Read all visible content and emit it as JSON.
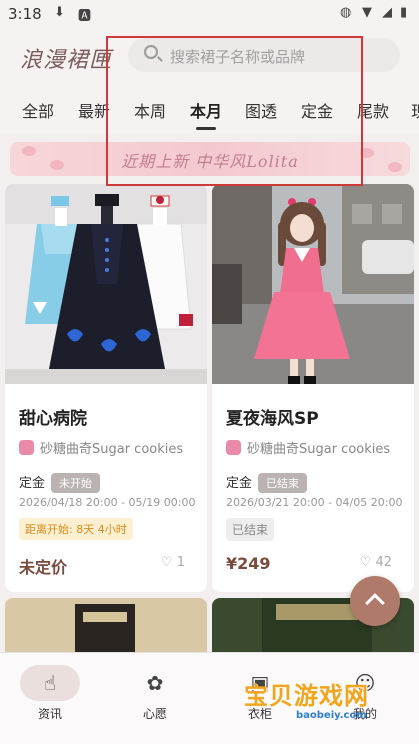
{
  "status_bar": {
    "time": "3:18"
  },
  "header": {
    "logo_text": "浪漫裙匣",
    "search_placeholder": "搜索裙子名称或品牌"
  },
  "tabs": [
    {
      "label": "全部",
      "active": false
    },
    {
      "label": "最新",
      "active": false
    },
    {
      "label": "本周",
      "active": false
    },
    {
      "label": "本月",
      "active": true
    },
    {
      "label": "图透",
      "active": false
    },
    {
      "label": "定金",
      "active": false
    },
    {
      "label": "尾款",
      "active": false
    },
    {
      "label": "现",
      "active": false
    }
  ],
  "banner": {
    "text": "近期上新 中华风Lolita"
  },
  "cards": [
    {
      "title": "甜心病院",
      "shop": "砂糖曲奇Sugar cookies",
      "stage": "定金",
      "status": "未开始",
      "dates": "2026/04/18 20:00 - 05/19 00:00",
      "countdown": "距离开始: 8天 4小时",
      "price": "未定价",
      "likes": "1"
    },
    {
      "title": "夏夜海风SP",
      "shop": "砂糖曲奇Sugar cookies",
      "stage": "定金",
      "status": "已结束",
      "dates": "2026/03/21 20:00 - 04/05 20:00",
      "ended_label": "已结束",
      "price": "¥249",
      "likes": "42"
    }
  ],
  "bottom_nav": [
    {
      "label": "资讯",
      "icon": "hand-icon",
      "active": true
    },
    {
      "label": "心愿",
      "icon": "flower-icon",
      "active": false
    },
    {
      "label": "衣柜",
      "icon": "wardrobe-icon",
      "active": false
    },
    {
      "label": "我的",
      "icon": "user-icon",
      "active": false
    }
  ],
  "watermark": {
    "text": "宝贝游戏网",
    "url": "baobeiy.com"
  },
  "colors": {
    "accent": "#b07a6a",
    "price": "#7a4a3e",
    "countdown": "#d98a1c",
    "red_highlight": "#cc3a3a"
  }
}
